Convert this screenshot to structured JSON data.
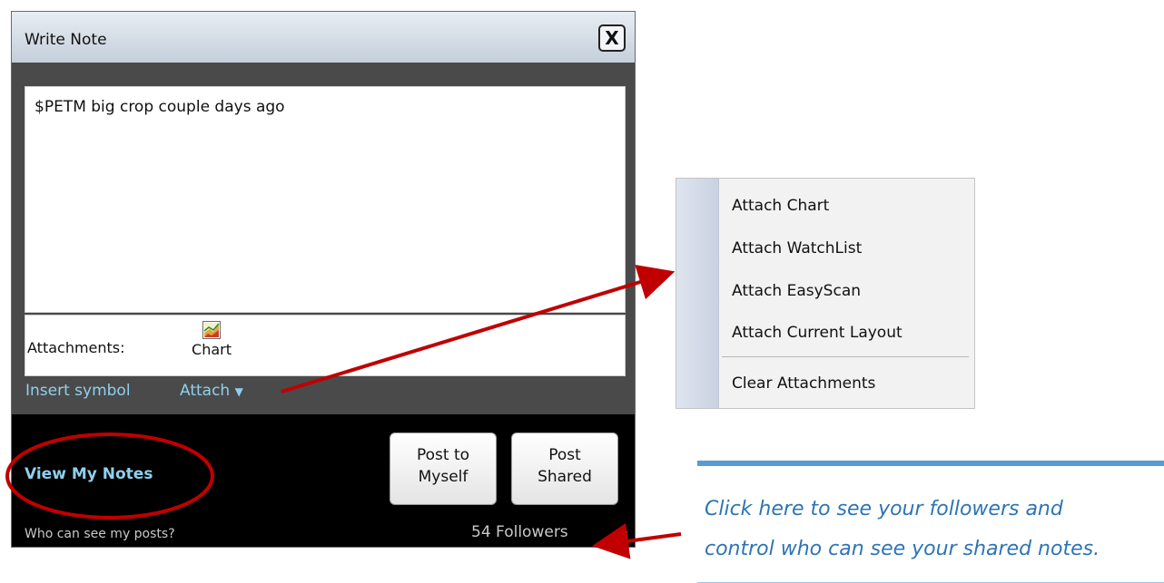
{
  "window": {
    "title": "Write Note",
    "close_label": "X"
  },
  "note": {
    "text": "$PETM big crop couple days ago"
  },
  "attachments": {
    "label": "Attachments:",
    "items": [
      {
        "label": "Chart",
        "icon": "chart-icon"
      }
    ]
  },
  "toolbar": {
    "insert_symbol": "Insert symbol",
    "attach": "Attach",
    "attach_caret": "▼"
  },
  "footer": {
    "view_my_notes": "View My Notes",
    "post_myself_line1": "Post to",
    "post_myself_line2": "Myself",
    "post_shared_line1": "Post",
    "post_shared_line2": "Shared",
    "who_can_see": "Who can see my posts?",
    "followers": "54 Followers"
  },
  "attach_menu": {
    "items": [
      "Attach Chart",
      "Attach WatchList",
      "Attach EasyScan",
      "Attach Current Layout",
      "Clear Attachments"
    ]
  },
  "callout": {
    "line1": "Click here to see your followers and",
    "line2": "control who can see your shared notes."
  },
  "colors": {
    "link": "#8fd0ee",
    "annotation_red": "#c00000",
    "callout_blue": "#2e74b5"
  }
}
